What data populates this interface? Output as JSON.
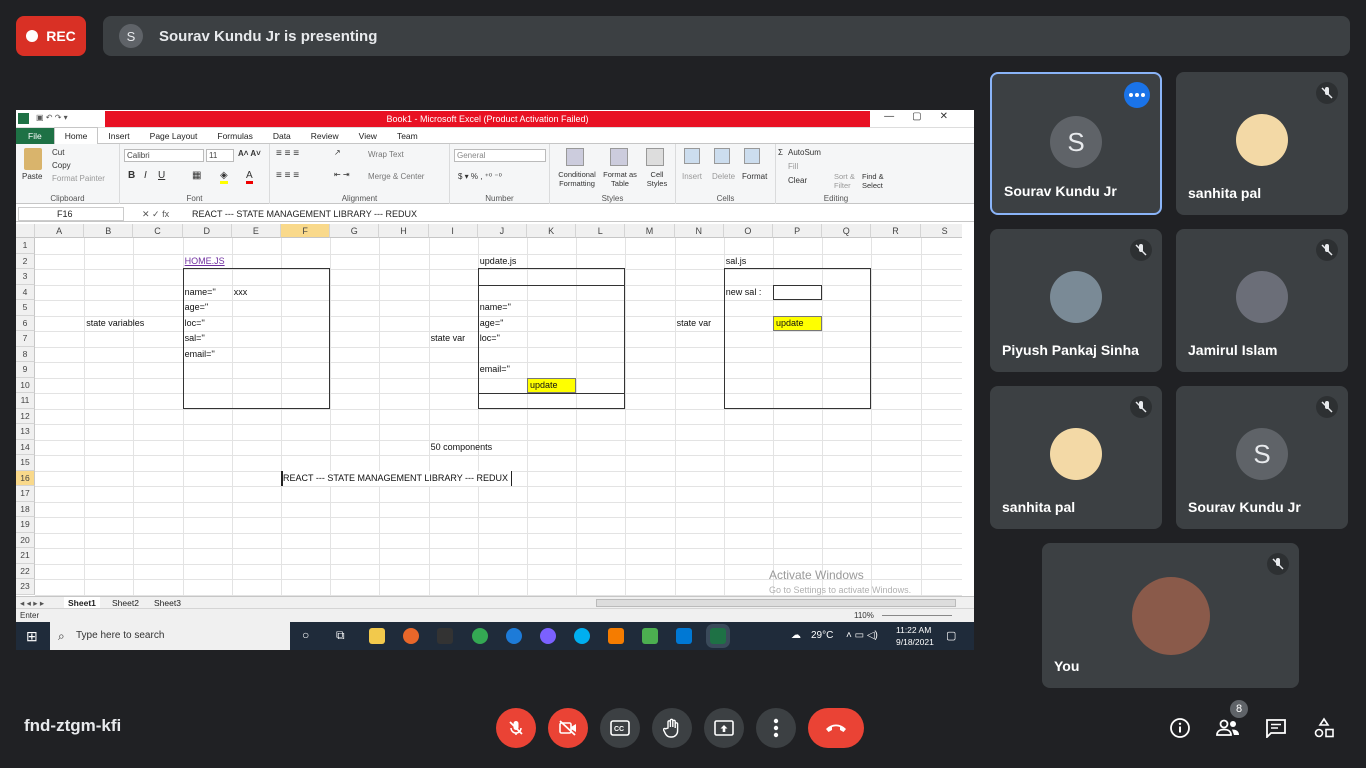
{
  "top": {
    "rec_label": "REC",
    "presenter_initial": "S",
    "presenting_text": "Sourav Kundu Jr is presenting"
  },
  "excel": {
    "title": "Book1  -  Microsoft Excel (Product Activation Failed)",
    "tabs": [
      "File",
      "Home",
      "Insert",
      "Page Layout",
      "Formulas",
      "Data",
      "Review",
      "View",
      "Team"
    ],
    "clipboard": {
      "paste": "Paste",
      "cut": "Cut",
      "copy": "Copy",
      "painter": "Format Painter",
      "label": "Clipboard"
    },
    "font": {
      "name": "Calibri",
      "size": "11",
      "label": "Font"
    },
    "alignment": {
      "wrap": "Wrap Text",
      "merge": "Merge & Center",
      "label": "Alignment"
    },
    "number": {
      "format": "General",
      "label": "Number"
    },
    "styles": {
      "cond": "Conditional Formatting",
      "table": "Format as Table",
      "cell": "Cell Styles",
      "label": "Styles"
    },
    "cells": {
      "insert": "Insert",
      "delete": "Delete",
      "format": "Format",
      "label": "Cells"
    },
    "editing": {
      "autosum": "AutoSum",
      "fill": "Fill",
      "clear": "Clear",
      "sort": "Sort & Filter",
      "find": "Find & Select",
      "label": "Editing"
    },
    "namebox": "F16",
    "formula": "REACT ---   STATE MANAGEMENT LIBRARY  ---  REDUX",
    "columns": [
      "A",
      "B",
      "C",
      "D",
      "E",
      "F",
      "G",
      "H",
      "I",
      "J",
      "K",
      "L",
      "M",
      "N",
      "O",
      "P",
      "Q",
      "R",
      "S"
    ],
    "rows": [
      "1",
      "2",
      "3",
      "4",
      "5",
      "6",
      "7",
      "8",
      "9",
      "10",
      "11",
      "12",
      "13",
      "14",
      "15",
      "16",
      "17",
      "18",
      "19",
      "20",
      "21",
      "22",
      "23"
    ],
    "cells_text": {
      "home_js": "HOME.JS",
      "name": "name=''",
      "xxx": "xxx",
      "age": "age=''",
      "loc": "loc=''",
      "sal": "sal=''",
      "email": "email=''",
      "state_variables": "state variables",
      "update_js": "update.js",
      "u_name": "name=''",
      "u_age": "age=''",
      "u_loc": "loc=''",
      "u_email": "email=''",
      "u_update": "update",
      "state_var1": "state var",
      "sal_js": "sal.js",
      "new_sal": "new sal :",
      "state_var2": "state var",
      "s_update": "update",
      "components": "50 components",
      "redux": "REACT ---   STATE MANAGEMENT LIBRARY  ---  REDUX"
    },
    "sheets": [
      "Sheet1",
      "Sheet2",
      "Sheet3"
    ],
    "status_mode": "Enter",
    "zoom": "110%",
    "watermark1": "Activate Windows",
    "watermark2": "Go to Settings to activate Windows.",
    "search_placeholder": "Type here to search",
    "temp": "29°C",
    "time": "11:22 AM",
    "date": "9/18/2021"
  },
  "participants": [
    {
      "name": "Sourav Kundu Jr",
      "initial": "S",
      "selected": true
    },
    {
      "name": "sanhita pal"
    },
    {
      "name": "Piyush Pankaj Sinha"
    },
    {
      "name": "Jamirul Islam"
    },
    {
      "name": "sanhita pal"
    },
    {
      "name": "Sourav Kundu Jr",
      "initial": "S"
    },
    {
      "name": "You"
    }
  ],
  "bottom": {
    "meeting_code": "fnd-ztgm-kfi",
    "people_count": "8"
  },
  "colors": {
    "red": "#ea4335",
    "bg": "#202124",
    "tile": "#3c4043",
    "accent": "#1a73e8"
  }
}
